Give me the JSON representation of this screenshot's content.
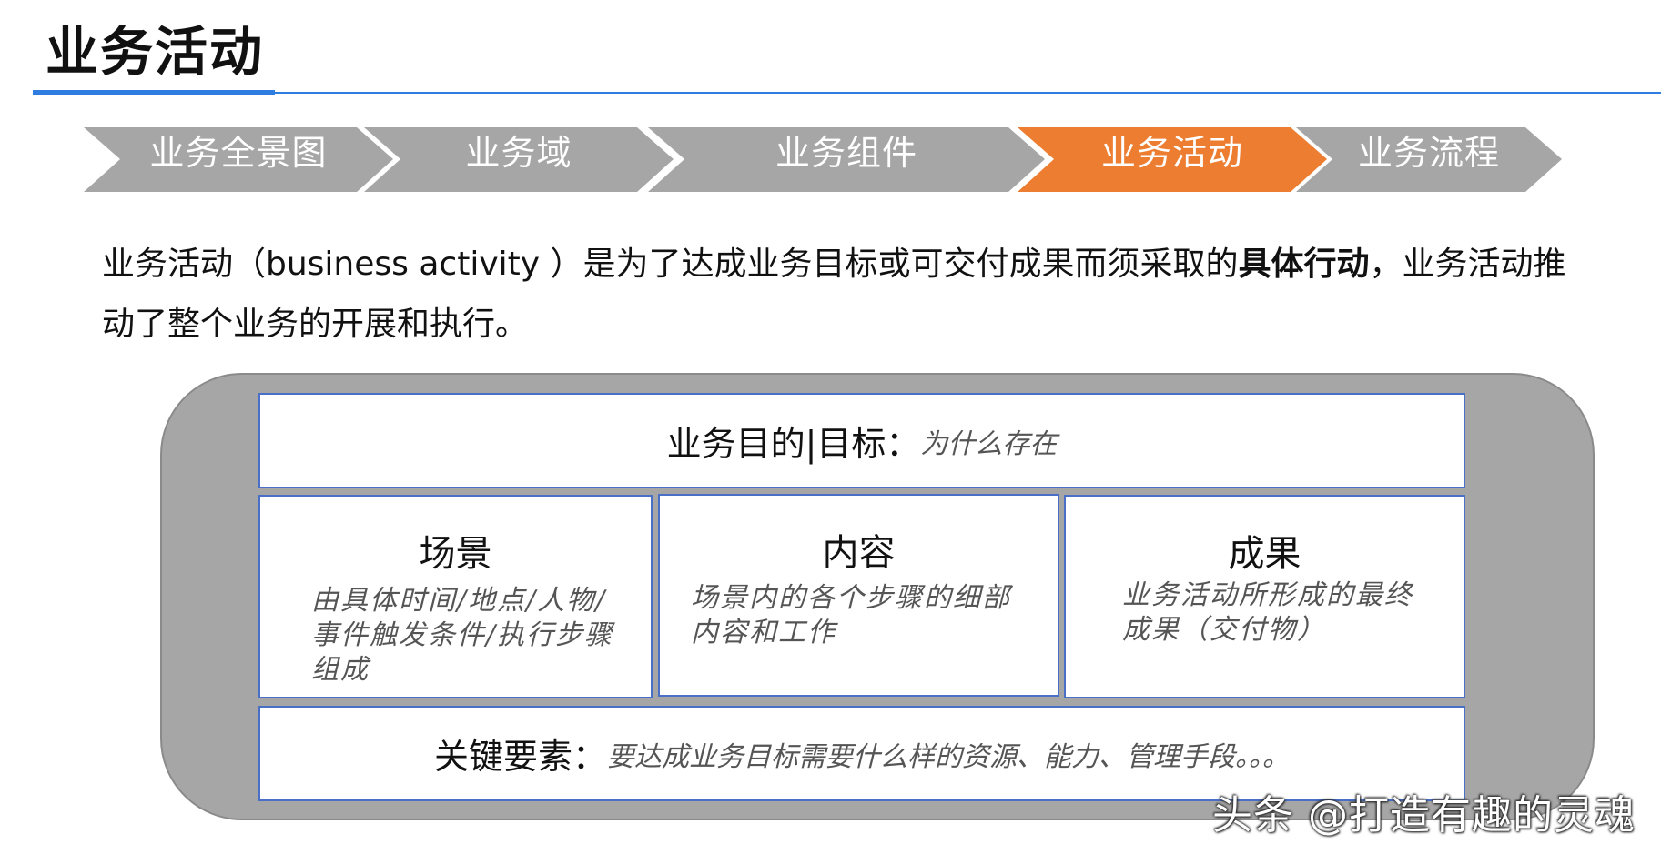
{
  "page": {
    "title": "业务活动",
    "accent_color": "#2f7de1"
  },
  "breadcrumb": {
    "steps": [
      {
        "label": "业务全景图",
        "active": false
      },
      {
        "label": "业务域",
        "active": false
      },
      {
        "label": "业务组件",
        "active": false
      },
      {
        "label": "业务活动",
        "active": true
      },
      {
        "label": "业务流程",
        "active": false
      }
    ],
    "inactive_color": "#a6a6a6",
    "active_color": "#ed7d31"
  },
  "intro": {
    "part1": "业务活动（business activity ）是为了达成业务目标或可交付成果而须采取的",
    "bold": "具体行动",
    "part2": "，业务活动推动了整个业务的开展和执行。"
  },
  "diagram": {
    "goal": {
      "label": "业务目的|目标：",
      "hint": "为什么存在"
    },
    "columns": [
      {
        "title": "场景",
        "desc": "由具体时间/地点/人物/事件触发条件/执行步骤组成"
      },
      {
        "title": "内容",
        "desc": "场景内的各个步骤的细部内容和工作"
      },
      {
        "title": "成果",
        "desc": "业务活动所形成的最终成果（交付物）"
      }
    ],
    "elements": {
      "label": "关键要素：",
      "hint": "要达成业务目标需要什么样的资源、能力、管理手段。。。"
    }
  },
  "watermark": "头条 @打造有趣的灵魂"
}
